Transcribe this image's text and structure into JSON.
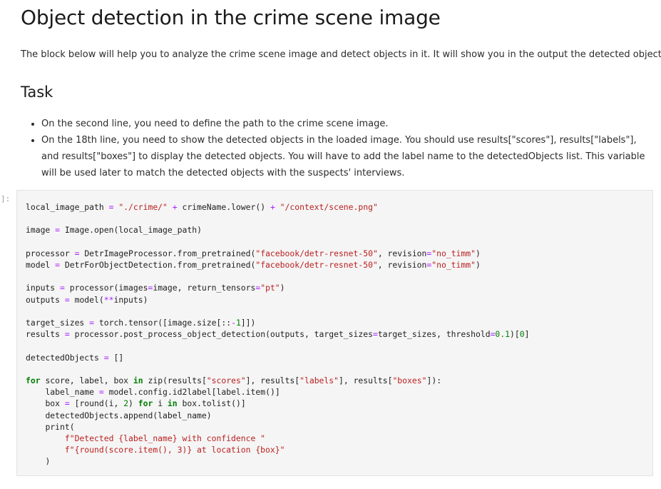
{
  "title": "Object detection in the crime scene image",
  "intro": "The block below will help you to analyze the crime scene image and detect objects in it. It will show you in the output the detected objects.",
  "task_heading": "Task",
  "task_items": [
    "On the second line, you need to define the path to the crime scene image.",
    "On the 18th line, you need to show the detected objects in the loaded image. You should use results[\"scores\"], results[\"labels\"], and results[\"boxes\"] to display the detected objects. You will have to add the label name to the detectedObjects list. This variable will be used later to match the detected objects with the suspects' interviews."
  ],
  "cell": {
    "prompt": "]:",
    "code_lines": [
      "local_image_path = \"./crime/\" + crimeName.lower() + \"/context/scene.png\"",
      "",
      "image = Image.open(local_image_path)",
      "",
      "processor = DetrImageProcessor.from_pretrained(\"facebook/detr-resnet-50\", revision=\"no_timm\")",
      "model = DetrForObjectDetection.from_pretrained(\"facebook/detr-resnet-50\", revision=\"no_timm\")",
      "",
      "inputs = processor(images=image, return_tensors=\"pt\")",
      "outputs = model(**inputs)",
      "",
      "target_sizes = torch.tensor([image.size[::-1]])",
      "results = processor.post_process_object_detection(outputs, target_sizes=target_sizes, threshold=0.1)[0]",
      "",
      "detectedObjects = []",
      "",
      "for score, label, box in zip(results[\"scores\"], results[\"labels\"], results[\"boxes\"]):",
      "    label_name = model.config.id2label[label.item()]",
      "    box = [round(i, 2) for i in box.tolist()]",
      "    detectedObjects.append(label_name)",
      "    print(",
      "        f\"Detected {label_name} with confidence \"",
      "        f\"{round(score.item(), 3)} at location {box}\"",
      "    )"
    ]
  },
  "colors": {
    "keyword": "#008000",
    "operator": "#aa22ff",
    "string": "#ba2121",
    "number": "#008000",
    "cell_background": "#f5f5f5"
  }
}
